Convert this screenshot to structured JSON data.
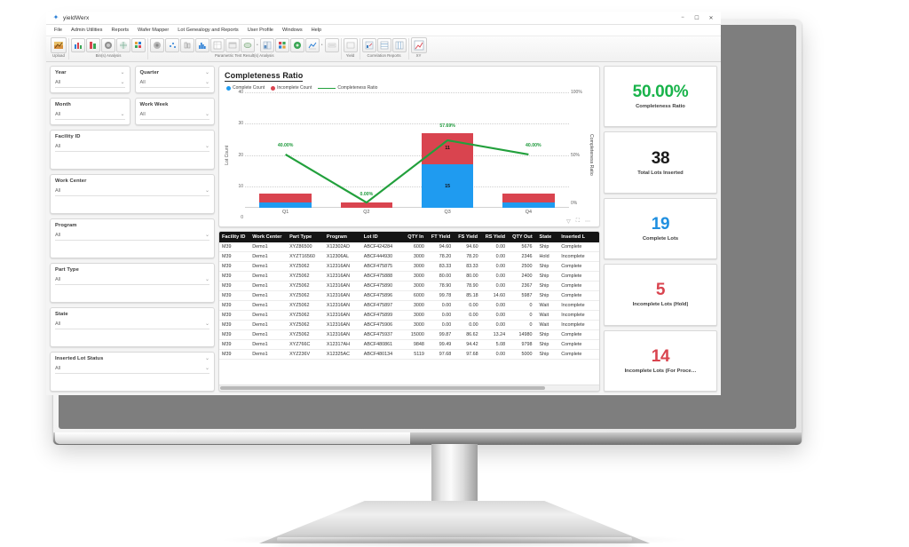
{
  "window": {
    "title": "yieldWerx",
    "logo_icon": "diamond-icon",
    "minimize_icon": "minimize-icon",
    "maximize_icon": "maximize-icon",
    "close_icon": "close-icon"
  },
  "menu": [
    {
      "label": "File"
    },
    {
      "label": "Admin Utilities"
    },
    {
      "label": "Reports"
    },
    {
      "label": "Wafer Mapper"
    },
    {
      "label": "Lot Genealogy and Reports"
    },
    {
      "label": "User Profile"
    },
    {
      "label": "Windows"
    },
    {
      "label": "Help"
    }
  ],
  "toolbar": {
    "groups": [
      {
        "label": "Upload",
        "buttons": [
          "upload-icon"
        ]
      },
      {
        "label": "Bin(s) Analysis",
        "buttons": [
          "bar-chart-icon",
          "stacked-bar-icon",
          "wafer-map-icon",
          "wafer-grid-icon",
          "mosaic-icon"
        ]
      },
      {
        "label": "Parametric Test Result(s) Analysis",
        "buttons": [
          "wafer-dark-icon",
          "scatter-icon",
          "box-plot-icon",
          "histogram-icon",
          "table-icon",
          "panel-icon",
          "trend-icon",
          "split-icon",
          "grid-chart-icon",
          "bin-colors-icon",
          "wafer-green-icon",
          "line-trend-icon",
          "overlay-icon"
        ]
      },
      {
        "label": "Yield",
        "buttons": [
          "yield-table-icon"
        ]
      },
      {
        "label": "Correlation Reports",
        "buttons": [
          "correlation-icon",
          "matrix-icon",
          "columns-icon"
        ]
      },
      {
        "label": "XY",
        "buttons": [
          "xy-plot-icon"
        ]
      }
    ]
  },
  "filters": {
    "caret_icon": "chevron-down-icon",
    "items": [
      {
        "label": "Year",
        "value": "All",
        "collapse_caret": true
      },
      {
        "label": "Quarter",
        "value": "All",
        "collapse_caret": true
      },
      {
        "label": "Month",
        "value": "All",
        "collapse_caret": false
      },
      {
        "label": "Work Week",
        "value": "All",
        "collapse_caret": false
      },
      {
        "label": "Facility ID",
        "value": "All",
        "collapse_caret": false
      },
      {
        "label": "Work Center",
        "value": "All",
        "collapse_caret": false
      },
      {
        "label": "Program",
        "value": "All",
        "collapse_caret": false
      },
      {
        "label": "Part Type",
        "value": "All",
        "collapse_caret": false
      },
      {
        "label": "State",
        "value": "All",
        "collapse_caret": false
      },
      {
        "label": "Inserted Lot Status",
        "value": "All",
        "collapse_caret": true
      }
    ]
  },
  "chart_data": {
    "type": "bar",
    "title": "Completeness Ratio",
    "xlabel": "",
    "ylabel": "Lot Count",
    "y2label": "Completeness Ratio",
    "ylim": [
      0,
      40
    ],
    "yticks": [
      0,
      10,
      20,
      30,
      40
    ],
    "y2lim": [
      0,
      100
    ],
    "y2ticks": [
      "0%",
      "50%",
      "100%"
    ],
    "grid": true,
    "legend_position": "top-left",
    "categories": [
      "Q1",
      "Q2",
      "Q3",
      "Q4"
    ],
    "series": [
      {
        "name": "Complete Count",
        "color": "#1f9bf0",
        "values": [
          2,
          0,
          15,
          2
        ],
        "labels": [
          "",
          "",
          "15",
          ""
        ]
      },
      {
        "name": "Incomplete Count",
        "color": "#d9444f",
        "values": [
          3,
          2,
          11,
          3
        ],
        "labels": [
          "",
          "",
          "11",
          ""
        ]
      },
      {
        "name": "Completeness Ratio",
        "color": "#22a03c",
        "type": "line",
        "values": [
          40.0,
          0.0,
          57.69,
          40.0
        ],
        "labels": [
          "40.00%",
          "0.00%",
          "57.69%",
          "40.00%"
        ]
      }
    ],
    "tools": [
      "filter-icon",
      "focus-icon",
      "more-icon"
    ]
  },
  "table": {
    "columns": [
      "Facility ID",
      "Work Center",
      "Part Type",
      "Program",
      "Lot ID",
      "QTY In",
      "FT Yield",
      "FS Yield",
      "RS Yield",
      "QTY Out",
      "State",
      "Inserted L"
    ],
    "sort_column": "Lot ID",
    "sort_icon": "sort-asc-icon",
    "rows": [
      [
        "M39",
        "Demo1",
        "XYZ86500",
        "X12302AD",
        "ABCF424284",
        "6000",
        "94.60",
        "94.60",
        "0.00",
        "5676",
        "Ship",
        "Complete"
      ],
      [
        "M39",
        "Demo1",
        "XYZT16560",
        "X12306AL",
        "ABCF444930",
        "3000",
        "78.20",
        "78.20",
        "0.00",
        "2346",
        "Hold",
        "Incomplete"
      ],
      [
        "M39",
        "Demo1",
        "XYZ5062",
        "X12316AN",
        "ABCF475875",
        "3000",
        "83.33",
        "83.33",
        "0.00",
        "2500",
        "Ship",
        "Complete"
      ],
      [
        "M39",
        "Demo1",
        "XYZ5062",
        "X12316AN",
        "ABCF475888",
        "3000",
        "80.00",
        "80.00",
        "0.00",
        "2400",
        "Ship",
        "Complete"
      ],
      [
        "M39",
        "Demo1",
        "XYZ5062",
        "X12316AN",
        "ABCF475890",
        "3000",
        "78.90",
        "78.90",
        "0.00",
        "2367",
        "Ship",
        "Complete"
      ],
      [
        "M39",
        "Demo1",
        "XYZ5062",
        "X12316AN",
        "ABCF475896",
        "6000",
        "99.78",
        "85.18",
        "14.60",
        "5987",
        "Ship",
        "Complete"
      ],
      [
        "M39",
        "Demo1",
        "XYZ5062",
        "X12316AN",
        "ABCF475897",
        "3000",
        "0.00",
        "0.00",
        "0.00",
        "0",
        "Wait",
        "Incomplete"
      ],
      [
        "M39",
        "Demo1",
        "XYZ5062",
        "X12316AN",
        "ABCF475899",
        "3000",
        "0.00",
        "0.00",
        "0.00",
        "0",
        "Wait",
        "Incomplete"
      ],
      [
        "M39",
        "Demo1",
        "XYZ5062",
        "X12316AN",
        "ABCF475906",
        "3000",
        "0.00",
        "0.00",
        "0.00",
        "0",
        "Wait",
        "Incomplete"
      ],
      [
        "M39",
        "Demo1",
        "XYZ5062",
        "X12316AN",
        "ABCF475937",
        "15000",
        "99.87",
        "86.62",
        "13.24",
        "14980",
        "Ship",
        "Complete"
      ],
      [
        "M39",
        "Demo1",
        "XYZ766C",
        "X12317AH",
        "ABCF480861",
        "9848",
        "99.49",
        "94.42",
        "5.08",
        "9798",
        "Ship",
        "Complete"
      ],
      [
        "M39",
        "Demo1",
        "XYZ236V",
        "X12325AC",
        "ABCF480134",
        "5119",
        "97.68",
        "97.68",
        "0.00",
        "5000",
        "Ship",
        "Complete"
      ]
    ]
  },
  "kpis": [
    {
      "value": "50.00%",
      "label": "Completeness Ratio",
      "color": "#18b34a"
    },
    {
      "value": "38",
      "label": "Total Lots Inserted",
      "color": "#1a1a1a"
    },
    {
      "value": "19",
      "label": "Complete Lots",
      "color": "#1f8fe0"
    },
    {
      "value": "5",
      "label": "Incomplete Lots (Hold)",
      "color": "#d9444f"
    },
    {
      "value": "14",
      "label": "Incomplete Lots (For Proce…",
      "color": "#d9444f"
    }
  ]
}
